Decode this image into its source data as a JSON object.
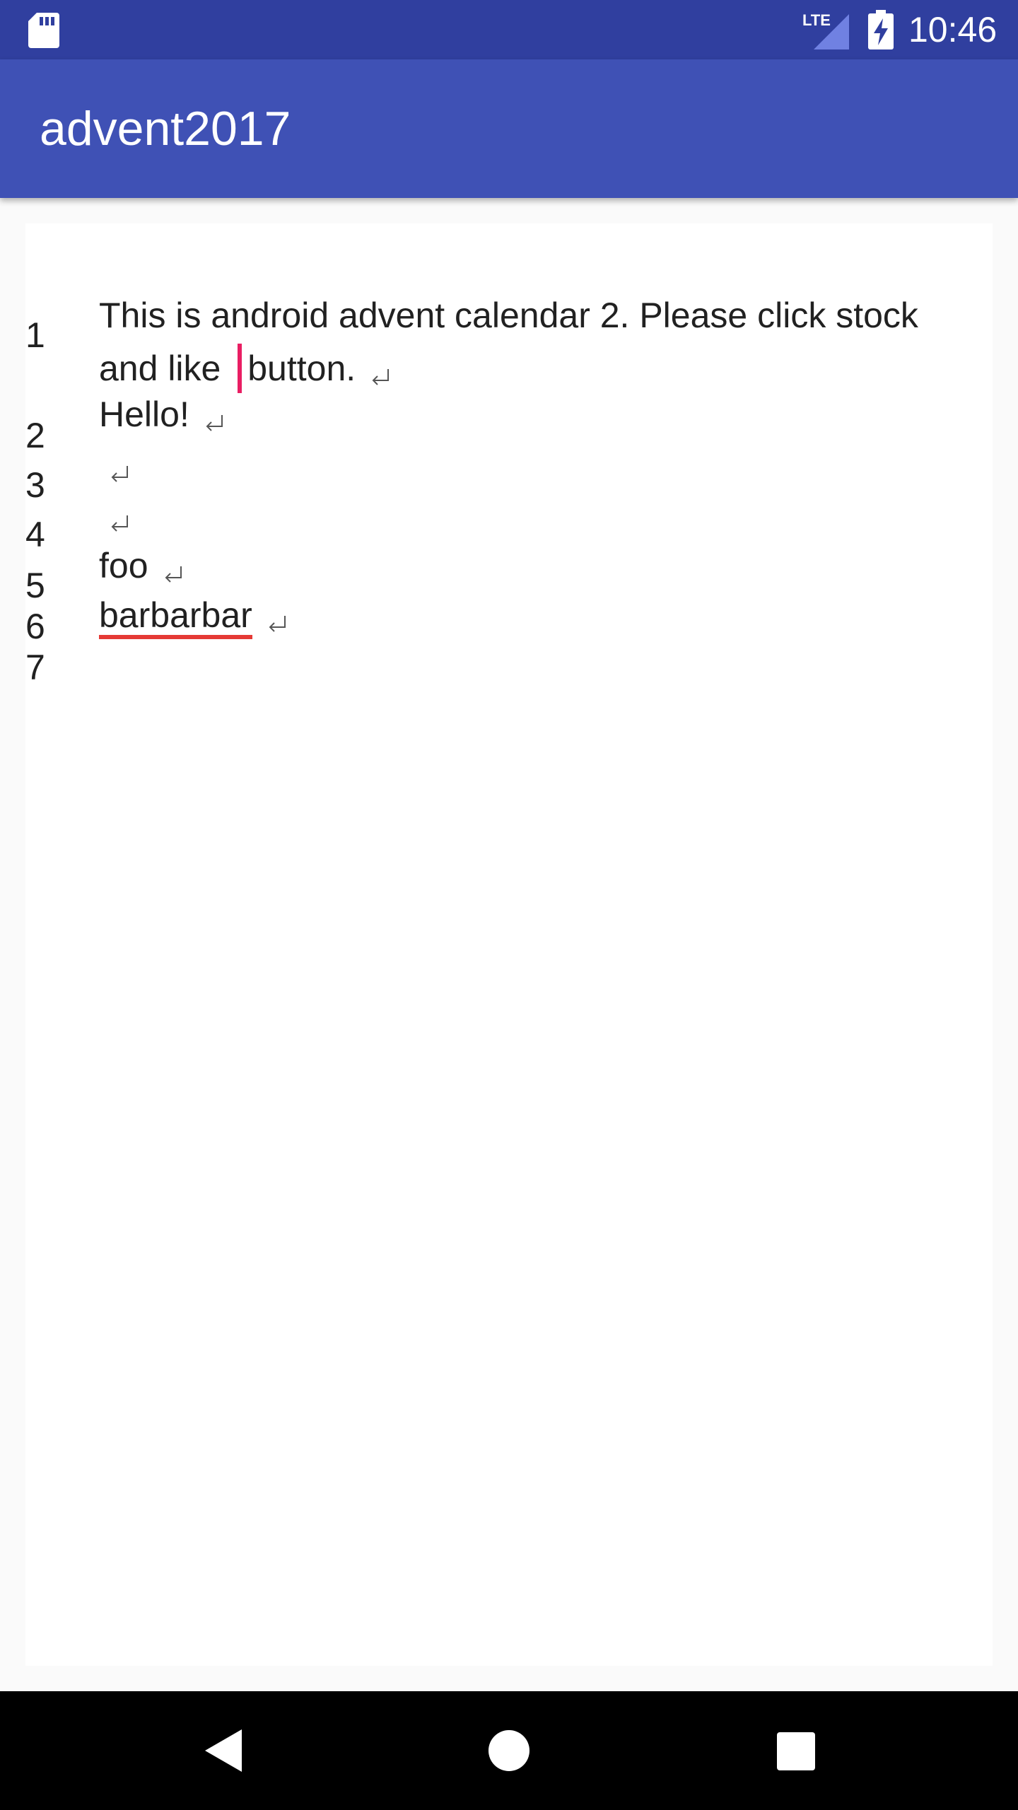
{
  "status_bar": {
    "time": "10:46",
    "network_label": "LTE",
    "icons": [
      "sd-card-icon",
      "lte-signal-icon",
      "battery-charging-icon"
    ]
  },
  "app_bar": {
    "title": "advent2017"
  },
  "editor": {
    "line_numbers": [
      "1",
      "2",
      "3",
      "4",
      "5",
      "6",
      "7"
    ],
    "line1_part1": "This is android advent calendar 2. Please click stock",
    "line1_part2a": "and like ",
    "line1_part2b": "button.",
    "line2": "Hello!",
    "line5": "foo",
    "line6": "barbarbar",
    "cursor_color": "#e91e63",
    "spellcheck_color": "#e53935"
  },
  "nav_bar": {
    "buttons": [
      "back-icon",
      "home-icon",
      "recents-icon"
    ]
  },
  "colors": {
    "status_bar": "#303f9f",
    "app_bar": "#3f51b5",
    "background": "#fafafa"
  }
}
